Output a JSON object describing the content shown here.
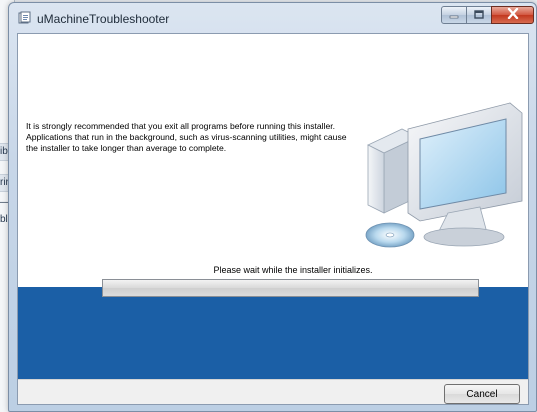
{
  "background_window": {
    "fragments": [
      "ib",
      "rir",
      "—",
      "bli"
    ]
  },
  "window": {
    "title": "uMachineTroubleshooter",
    "icon": "installer-icon",
    "controls": {
      "minimize": "minimize-icon",
      "maximize": "maximize-icon",
      "close": "close-icon"
    }
  },
  "content": {
    "message": "It is strongly recommended that you exit all programs before running this installer. Applications that run in the background, such as virus-scanning utilities, might cause the installer to take longer than average to complete.",
    "status": "Please wait while the installer initializes.",
    "illustration": "computer-install-icon"
  },
  "progress": {
    "value_percent": 0
  },
  "footer": {
    "cancel_label": "Cancel"
  },
  "colors": {
    "band": "#1b5fa6",
    "close_button": "#c2381f"
  }
}
